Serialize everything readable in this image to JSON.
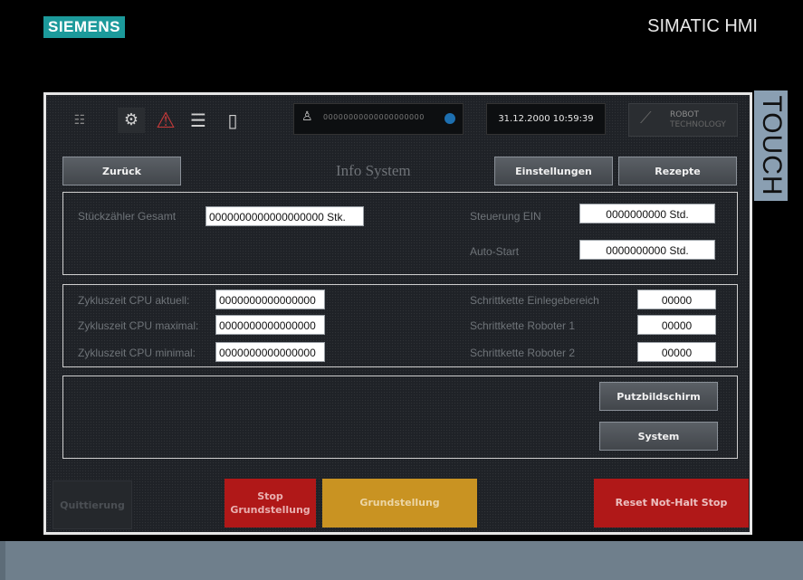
{
  "device": {
    "brand": "SIEMENS",
    "product": "SIMATIC HMI",
    "touch_label": "TOUCH"
  },
  "topbar": {
    "user_text": "00000000000000000000",
    "datetime": "31.12.2000 10:59:39",
    "logo_line1": "ROBOT",
    "logo_line2": "TECHNOLOGY",
    "icons": [
      "menu-icon",
      "robot-icon",
      "warning-icon",
      "list-icon",
      "door-icon",
      "user-icon",
      "refresh-icon"
    ]
  },
  "nav": {
    "back": "Zurück",
    "title": "Info System",
    "settings": "Einstellungen",
    "recipes": "Rezepte"
  },
  "counters": {
    "total_label": "Stückzähler Gesamt",
    "total_value": "0000000000000000000 Stk.",
    "control_on_label": "Steuerung EIN",
    "control_on_value": "0000000000 Std.",
    "autostart_label": "Auto-Start",
    "autostart_value": "0000000000 Std."
  },
  "cycle": {
    "current_label": "Zykluszeit CPU aktuell:",
    "current_value": "0000000000000000",
    "max_label": "Zykluszeit CPU maximal:",
    "max_value": "0000000000000000",
    "min_label": "Zykluszeit CPU minimal:",
    "min_value": "0000000000000000",
    "step1_label": "Schrittkette Einlegebereich",
    "step1_value": "00000",
    "step2_label": "Schrittkette Roboter 1",
    "step2_value": "00000",
    "step3_label": "Schrittkette Roboter 2",
    "step3_value": "00000"
  },
  "actions": {
    "clean_screen": "Putzbildschirm",
    "system": "System"
  },
  "bottom": {
    "acknowledge": "Quittierung",
    "stop_line1": "Stop",
    "stop_line2": "Grundstellung",
    "home": "Grundstellung",
    "reset": "Reset Not-Halt Stop"
  },
  "colors": {
    "screen_bg": "#1f2227",
    "stop_bg": "#b01818",
    "home_bg": "#c99322",
    "reset_bg": "#b01818",
    "brand_bg": "#1c9a9b"
  }
}
